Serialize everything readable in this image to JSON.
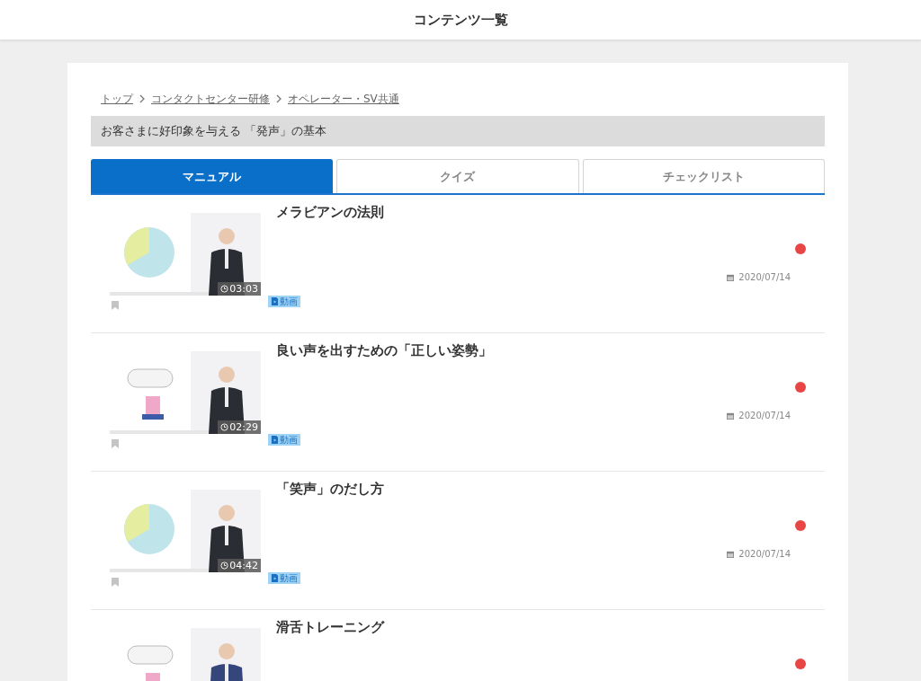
{
  "header": {
    "title": "コンテンツ一覧"
  },
  "breadcrumb": [
    "トップ",
    "コンタクトセンター研修",
    "オペレーター・SV共通"
  ],
  "course_title": "お客さまに好印象を与える 「発声」の基本",
  "tabs": [
    {
      "label": "マニュアル",
      "selected": true
    },
    {
      "label": "クイズ",
      "selected": false
    },
    {
      "label": "チェックリスト",
      "selected": false
    }
  ],
  "items": [
    {
      "title": "メラビアンの法則",
      "duration": "03:03",
      "date": "2020/07/14",
      "tag": "動画",
      "unread": true,
      "bookmarked": false
    },
    {
      "title": "良い声を出すための「正しい姿勢」",
      "duration": "02:29",
      "date": "2020/07/14",
      "tag": "動画",
      "unread": true,
      "bookmarked": false
    },
    {
      "title": "「笑声」のだし方",
      "duration": "04:42",
      "date": "2020/07/14",
      "tag": "動画",
      "unread": true,
      "bookmarked": false
    },
    {
      "title": "滑舌トレーニング",
      "unread": true
    }
  ]
}
